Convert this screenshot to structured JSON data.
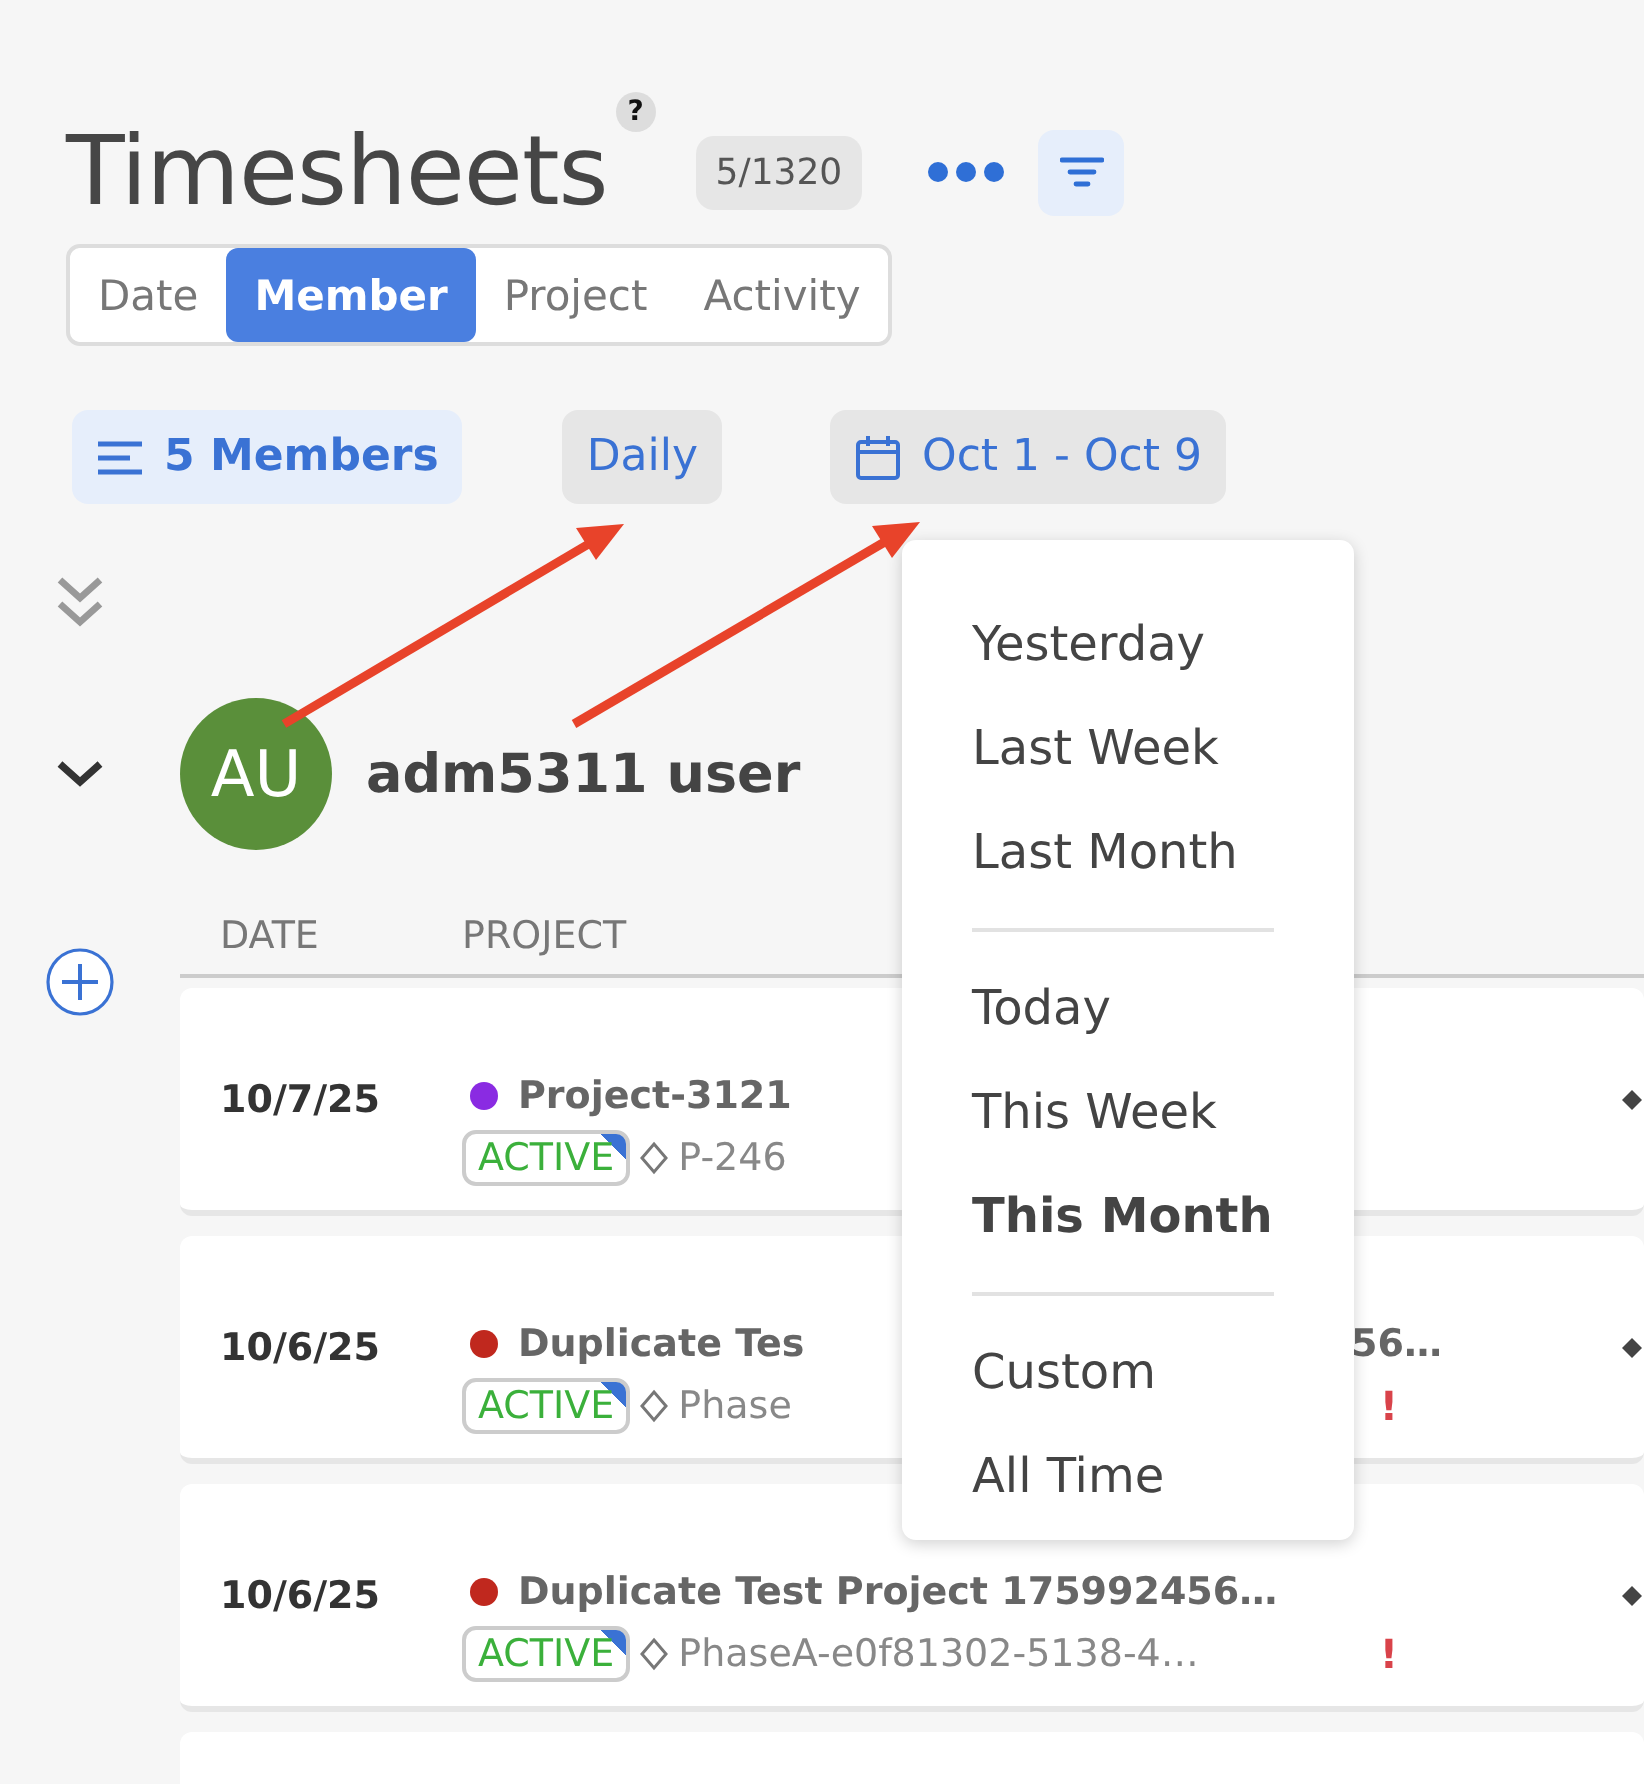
{
  "page": {
    "title": "Timesheets",
    "help": "?",
    "count": "5/1320"
  },
  "view_tabs": [
    {
      "label": "Date",
      "selected": false
    },
    {
      "label": "Member",
      "selected": true
    },
    {
      "label": "Project",
      "selected": false
    },
    {
      "label": "Activity",
      "selected": false
    }
  ],
  "members_filter": "5 Members",
  "interval": "Daily",
  "date_range": "Oct 1 - Oct 9",
  "member": {
    "initials": "AU",
    "name": "adm5311 user",
    "expanded": true
  },
  "table": {
    "columns": [
      "DATE",
      "PROJECT"
    ],
    "rows": [
      {
        "date": "10/7/25",
        "color": "#8a2be2",
        "title": "Project-3121",
        "status": "ACTIVE",
        "code": "P-246"
      },
      {
        "date": "10/6/25",
        "color": "#c0281e",
        "title": "Duplicate Tes",
        "title_tail": "56…",
        "status": "ACTIVE",
        "code": "Phase",
        "flag": "!"
      },
      {
        "date": "10/6/25",
        "color": "#c0281e",
        "title": "Duplicate Test Project 175992456…",
        "status": "ACTIVE",
        "code": "PhaseA-e0f81302-5138-4…",
        "flag": "!"
      }
    ]
  },
  "date_menu": {
    "groups": [
      [
        {
          "label": "Yesterday",
          "selected": false
        },
        {
          "label": "Last Week",
          "selected": false
        },
        {
          "label": "Last Month",
          "selected": false
        }
      ],
      [
        {
          "label": "Today",
          "selected": false
        },
        {
          "label": "This Week",
          "selected": false
        },
        {
          "label": "This Month",
          "selected": true
        }
      ],
      [
        {
          "label": "Custom",
          "selected": false
        },
        {
          "label": "All Time",
          "selected": false
        }
      ]
    ]
  }
}
